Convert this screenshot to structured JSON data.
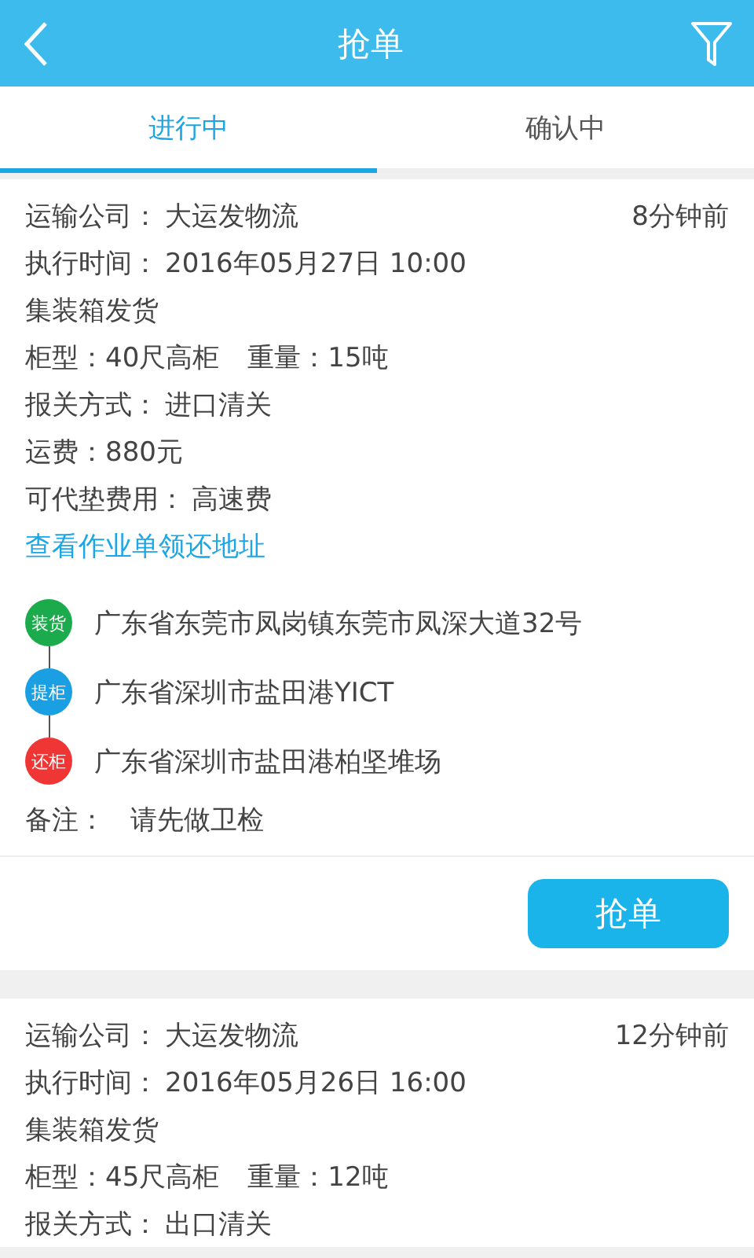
{
  "header": {
    "title": "抢单"
  },
  "tabs": [
    {
      "label": "进行中",
      "selected": true
    },
    {
      "label": "确认中",
      "selected": false
    }
  ],
  "orders": [
    {
      "time": "8分钟前",
      "rows": [
        {
          "kind": "field",
          "texts": [
            "运输公司：",
            "大运发物流"
          ]
        },
        {
          "kind": "field",
          "texts": [
            "执行时间：",
            "2016年05月27日 10:00"
          ]
        },
        {
          "kind": "plain",
          "texts": [
            "集装箱发货"
          ]
        },
        {
          "kind": "field",
          "texts": [
            "柜型：40尺高柜",
            "重量：15吨"
          ]
        },
        {
          "kind": "field",
          "texts": [
            "报关方式：",
            "进口清关"
          ]
        },
        {
          "kind": "plain",
          "texts": [
            "运费：880元"
          ]
        },
        {
          "kind": "field",
          "texts": [
            "可代垫费用：",
            "高速费"
          ]
        },
        {
          "kind": "link",
          "texts": [
            "查看作业单领还地址"
          ]
        }
      ],
      "stops": [
        {
          "tag": "装货",
          "address": "广东省东莞市凤岗镇东莞市凤深大道32号",
          "color": "#1bab4c"
        },
        {
          "tag": "提柜",
          "address": "广东省深圳市盐田港YICT",
          "color": "#1a9fe3"
        },
        {
          "tag": "还柜",
          "address": "广东省深圳市盐田港柏坚堆场",
          "color": "#f03535"
        }
      ],
      "note": {
        "label": "备注：",
        "value": "请先做卫检"
      },
      "button": "抢单"
    },
    {
      "time": "12分钟前",
      "rows": [
        {
          "kind": "field",
          "texts": [
            "运输公司：",
            "大运发物流"
          ]
        },
        {
          "kind": "field",
          "texts": [
            "执行时间：",
            "2016年05月26日 16:00"
          ]
        },
        {
          "kind": "plain",
          "texts": [
            "集装箱发货"
          ]
        },
        {
          "kind": "field",
          "texts": [
            "柜型：45尺高柜",
            "重量：12吨"
          ]
        },
        {
          "kind": "field",
          "texts": [
            "报关方式：",
            "出口清关"
          ]
        }
      ]
    }
  ]
}
